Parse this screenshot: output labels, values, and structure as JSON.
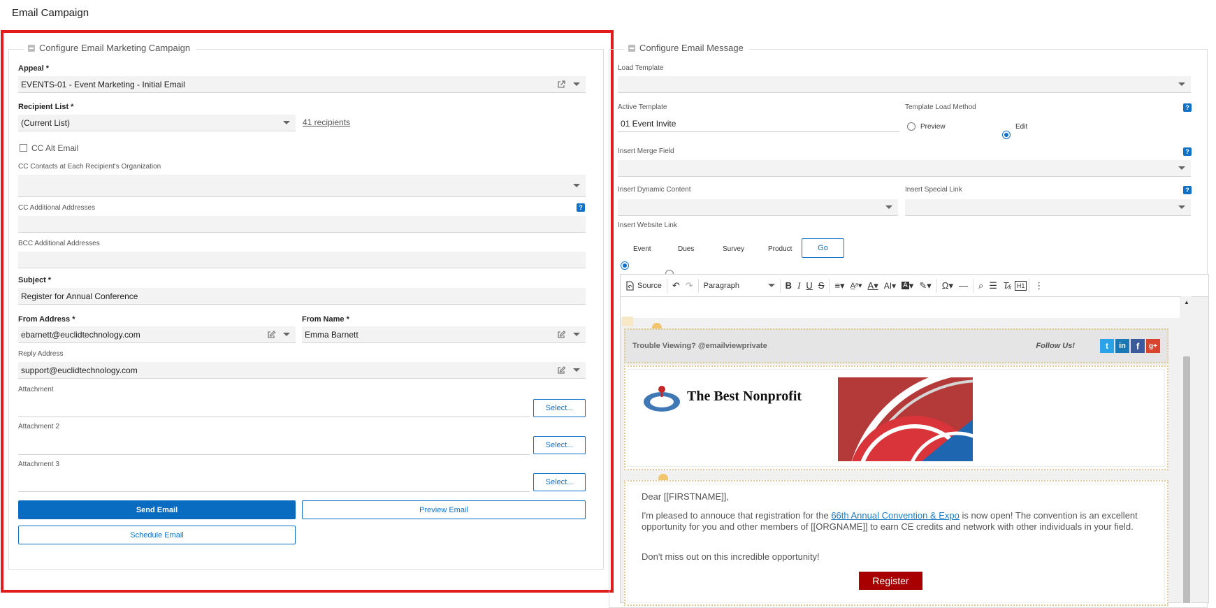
{
  "page": {
    "title": "Email Campaign"
  },
  "left": {
    "legend": "Configure Email Marketing Campaign",
    "appeal": {
      "label": "Appeal *",
      "value": "EVENTS-01 - Event Marketing - Initial Email"
    },
    "recipient_list": {
      "label": "Recipient List *",
      "value": "(Current List)",
      "link": "41 recipients"
    },
    "cc_alt_email": {
      "label": "CC Alt Email",
      "checked": false
    },
    "cc_contacts": {
      "label": "CC Contacts at Each Recipient's Organization",
      "value": ""
    },
    "cc_additional": {
      "label": "CC Additional Addresses",
      "value": ""
    },
    "bcc_additional": {
      "label": "BCC Additional Addresses",
      "value": ""
    },
    "subject": {
      "label": "Subject *",
      "value": "Register for Annual Conference"
    },
    "from_address": {
      "label": "From Address *",
      "value": "ebarnett@euclidtechnology.com"
    },
    "from_name": {
      "label": "From Name *",
      "value": "Emma Barnett"
    },
    "reply_address": {
      "label": "Reply Address",
      "value": "support@euclidtechnology.com"
    },
    "attachments": [
      {
        "label": "Attachment",
        "button": "Select..."
      },
      {
        "label": "Attachment 2",
        "button": "Select..."
      },
      {
        "label": "Attachment 3",
        "button": "Select..."
      }
    ],
    "buttons": {
      "send": "Send Email",
      "preview": "Preview Email",
      "schedule": "Schedule Email"
    }
  },
  "right": {
    "legend": "Configure Email Message",
    "load_template": {
      "label": "Load Template",
      "value": ""
    },
    "active_template": {
      "label": "Active Template",
      "value": "01 Event Invite"
    },
    "template_load_method": {
      "label": "Template Load Method",
      "options": [
        "Preview",
        "Edit"
      ],
      "selected": "Edit"
    },
    "insert_merge_field": {
      "label": "Insert Merge Field",
      "value": ""
    },
    "insert_dynamic_content": {
      "label": "Insert Dynamic Content",
      "value": ""
    },
    "insert_special_link": {
      "label": "Insert Special Link",
      "value": ""
    },
    "insert_website_link": {
      "label": "Insert Website Link",
      "options": [
        "Event",
        "Dues",
        "Survey",
        "Product"
      ],
      "selected": "Event",
      "go": "Go"
    },
    "help_glyph": "?",
    "toolbar": {
      "source": "Source",
      "block_format": "Paragraph"
    },
    "email": {
      "trouble": "Trouble Viewing? @emailviewprivate",
      "follow": "Follow Us!",
      "org_name": "The Best Nonprofit",
      "greeting": "Dear [[FIRSTNAME]],",
      "para1_pre": "I'm pleased to annouce that registration for the ",
      "para1_link": "66th Annual Convention & Expo",
      "para1_post": " is now open! The convention is an excellent opportunity for you and other members of [[ORGNAME]] to earn CE credits and network with other individuals in your field.",
      "para2": "Don't miss out on this incredible opportunity!",
      "register": "Register"
    }
  },
  "colors": {
    "primary": "#0a6cc0",
    "highlight": "#e01b1b",
    "register": "#a80000"
  }
}
